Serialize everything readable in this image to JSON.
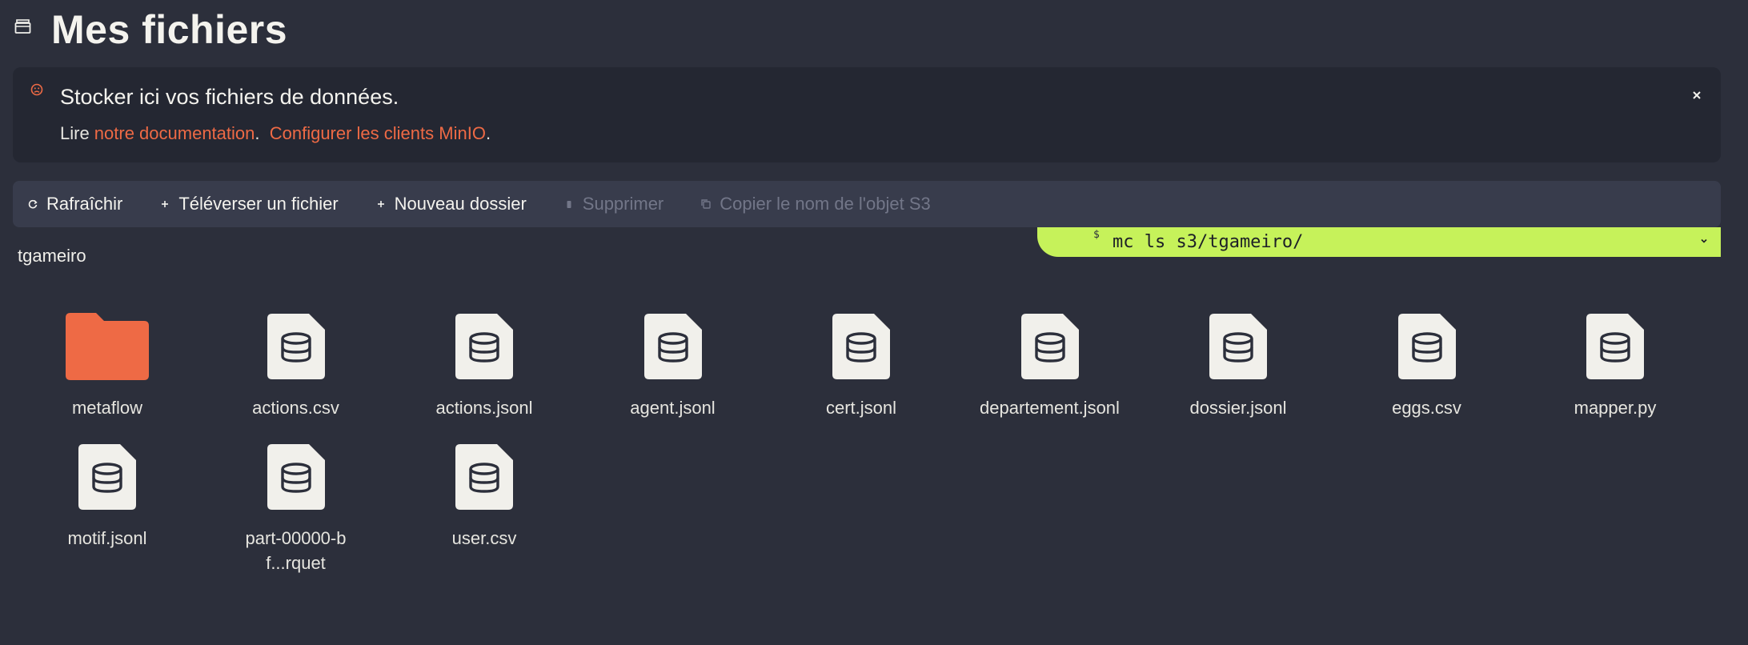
{
  "header": {
    "title": "Mes fichiers",
    "icon": "folder-stack-icon"
  },
  "alert": {
    "icon": "alert-face-icon",
    "title": "Stocker ici vos fichiers de données.",
    "lead": "Lire ",
    "link1": "notre documentation",
    "sep1": ".  ",
    "link2": "Configurer les clients MinIO",
    "sep2": ".",
    "close_icon": "close-icon",
    "accent_color": "#ee6a45"
  },
  "toolbar": {
    "refresh": "Rafraîchir",
    "upload": "Téléverser un fichier",
    "new_folder": "Nouveau dossier",
    "delete": "Supprimer",
    "copy_name": "Copier le nom de l'objet S3"
  },
  "terminal": {
    "prompt": "$",
    "command": "mc ls s3/tgameiro/",
    "color": "#c6f25a"
  },
  "breadcrumb": "tgameiro",
  "files": [
    {
      "name": "metaflow",
      "kind": "folder"
    },
    {
      "name": "actions.csv",
      "kind": "file"
    },
    {
      "name": "actions.jsonl",
      "kind": "file"
    },
    {
      "name": "agent.jsonl",
      "kind": "file"
    },
    {
      "name": "cert.jsonl",
      "kind": "file"
    },
    {
      "name": "departement.jsonl",
      "kind": "file"
    },
    {
      "name": "dossier.jsonl",
      "kind": "file"
    },
    {
      "name": "eggs.csv",
      "kind": "file"
    },
    {
      "name": "mapper.py",
      "kind": "file"
    },
    {
      "name": "motif.jsonl",
      "kind": "file"
    },
    {
      "name": "part-00000-bf...rquet",
      "kind": "file"
    },
    {
      "name": "user.csv",
      "kind": "file"
    }
  ],
  "colors": {
    "background": "#2c2f3b",
    "folder": "#ee6a45",
    "file_icon": "#f1f0eb"
  }
}
